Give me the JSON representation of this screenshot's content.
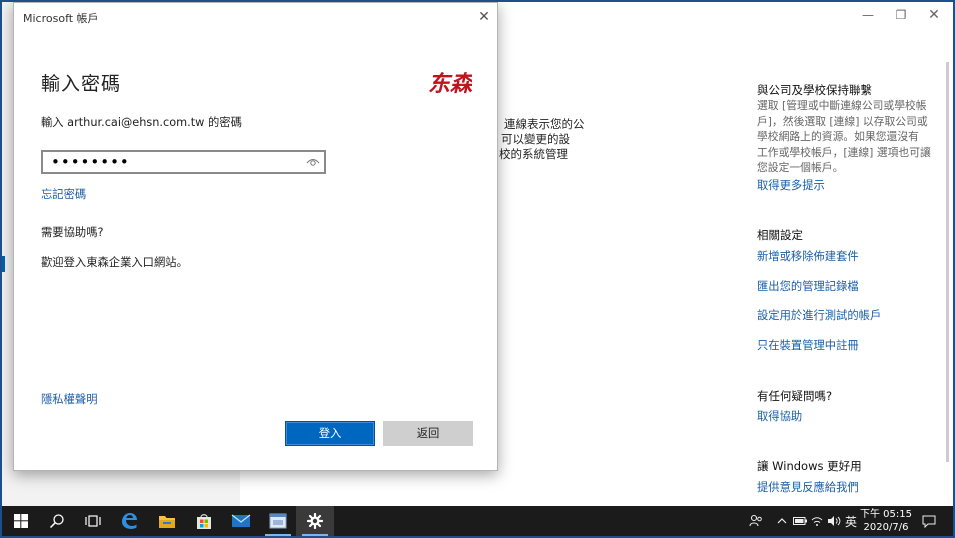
{
  "dialog": {
    "title": "Microsoft 帳戶",
    "heading": "輸入密碼",
    "prompt": "輸入 arthur.cai@ehsn.com.tw 的密碼",
    "password_masked": "••••••••",
    "forgot_link": "忘記密碼",
    "help_heading": "需要協助嗎?",
    "help_text": "歡迎登入東森企業入口網站。",
    "privacy_link": "隱私權聲明",
    "sign_in_button": "登入",
    "back_button": "返回",
    "logo_text": "东森",
    "logo_color": "#c0141c"
  },
  "background": {
    "partial_lines": [
      "連線表示您的公",
      "可以變更的設",
      "校的系統管理"
    ],
    "right_panel": {
      "connect_heading": "與公司及學校保持聯繫",
      "connect_lines": [
        "選取 [管理或中斷連線公司或學校帳",
        "戶]，然後選取 [連線] 以存取公司或",
        "學校網路上的資源。如果您還沒有",
        "工作或學校帳戶，[連線] 選項也可讓",
        "您設定一個帳戶。"
      ],
      "connect_link": "取得更多提示",
      "related_heading": "相關設定",
      "related_links": [
        "新增或移除佈建套件",
        "匯出您的管理記錄檔",
        "設定用於進行測試的帳戶",
        "只在裝置管理中註冊"
      ],
      "question_heading": "有任何疑問嗎?",
      "question_link": "取得協助",
      "better_heading": "讓 Windows 更好用",
      "better_link": "提供意見反應給我們"
    }
  },
  "taskbar": {
    "ime": "英",
    "time": "下午 05:15",
    "date": "2020/7/6"
  },
  "colors": {
    "accent": "#0067c0",
    "link": "#1a5ea8",
    "taskbar": "#1b1b1b"
  }
}
